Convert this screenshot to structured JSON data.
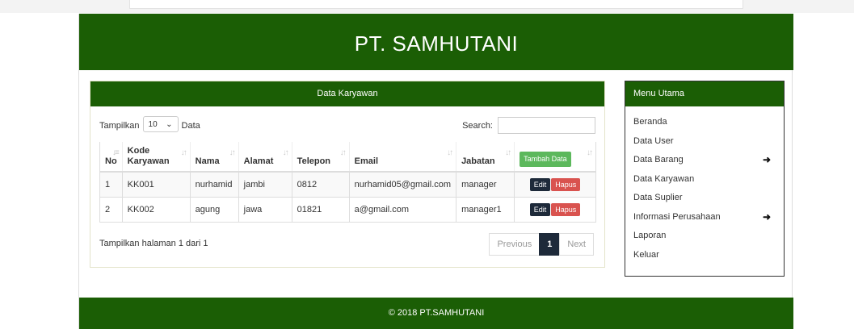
{
  "site": {
    "title": "PT. SAMHUTANI",
    "footer": "© 2018 PT.SAMHUTANI"
  },
  "panel": {
    "title": "Data Karyawan",
    "show_label": "Tampilkan",
    "page_length": "10",
    "data_label": "Data",
    "search_label": "Search:",
    "search_value": ""
  },
  "table": {
    "columns": [
      "No",
      "Kode Karyawan",
      "Nama",
      "Alamat",
      "Telepon",
      "Email",
      "Jabatan"
    ],
    "add_button": "Tambah Data",
    "edit_label": "Edit",
    "delete_label": "Hapus",
    "rows": [
      {
        "no": "1",
        "kode": "KK001",
        "nama": "nurhamid",
        "alamat": "jambi",
        "telepon": "0812",
        "email": "nurhamid05@gmail.com",
        "jabatan": "manager"
      },
      {
        "no": "2",
        "kode": "KK002",
        "nama": "agung",
        "alamat": "jawa",
        "telepon": "01821",
        "email": "a@gmail.com",
        "jabatan": "manager1"
      }
    ]
  },
  "pagination": {
    "info": "Tampilkan halaman 1 dari 1",
    "previous": "Previous",
    "current": "1",
    "next": "Next"
  },
  "menu": {
    "title": "Menu Utama",
    "items": [
      {
        "label": "Beranda"
      },
      {
        "label": "Data User"
      },
      {
        "label": "Data Barang",
        "has_submenu": true
      },
      {
        "label": "Data Karyawan"
      },
      {
        "label": "Data Suplier"
      },
      {
        "label": "Informasi Perusahaan",
        "has_submenu": true
      },
      {
        "label": "Laporan"
      },
      {
        "label": "Keluar"
      }
    ]
  },
  "colors": {
    "header_green": "#1b5e05",
    "add_green": "#5cb85c",
    "delete_red": "#d9534f",
    "edit_navy": "#1e2a3a"
  }
}
